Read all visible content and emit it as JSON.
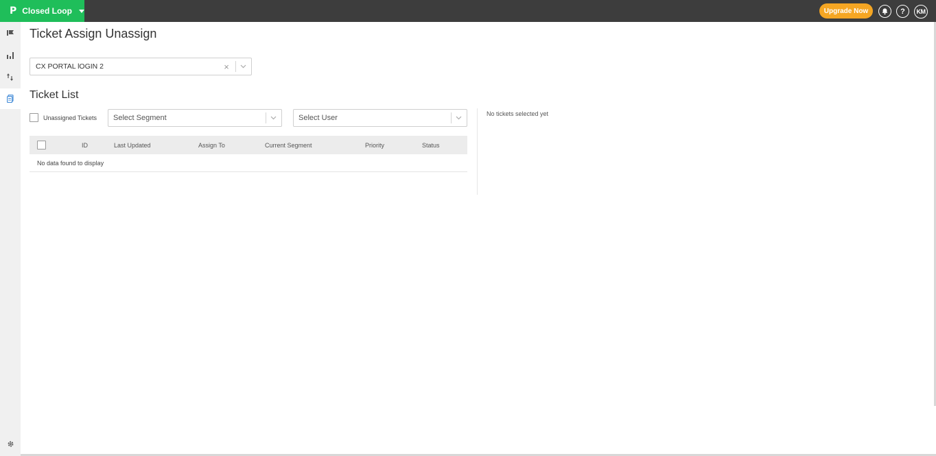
{
  "topbar": {
    "product_logo": "P",
    "product_name": "Closed Loop",
    "upgrade_label": "Upgrade Now",
    "help_label": "?",
    "avatar_initials": "KM"
  },
  "rail": {
    "items": [
      "flag-icon",
      "bar-chart-icon",
      "sort-arrows-icon",
      "tickets-icon"
    ],
    "active": "tickets-icon",
    "bottom": "settings-icon"
  },
  "page": {
    "title": "Ticket Assign Unassign",
    "survey_value": "CX PORTAL lOGIN 2",
    "clear_symbol": "×",
    "section_title": "Ticket List",
    "unassigned_label": "Unassigned Tickets",
    "segment_placeholder": "Select Segment",
    "user_placeholder": "Select User"
  },
  "table": {
    "columns": [
      "ID",
      "Last Updated",
      "Assign To",
      "Current Segment",
      "Priority",
      "Status"
    ],
    "empty_text": "No data found to display"
  },
  "side_panel": {
    "empty_text": "No tickets selected yet"
  },
  "colors": {
    "brand_green": "#1fbe5a",
    "topbar": "#3d3d3d",
    "upgrade": "#f5a623",
    "active_icon": "#4a90d9"
  }
}
